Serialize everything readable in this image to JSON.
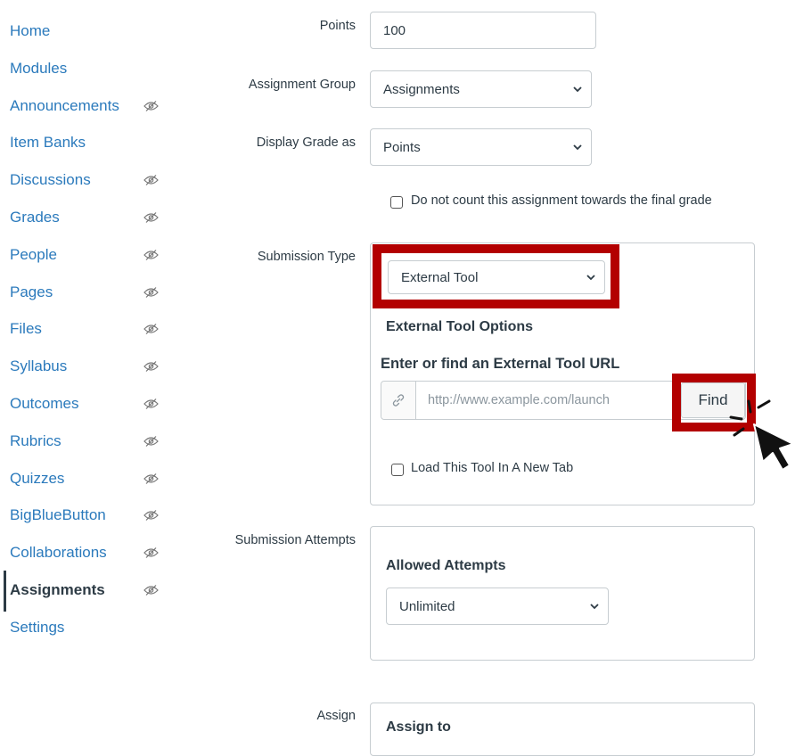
{
  "sidebar": {
    "items": [
      {
        "label": "Home",
        "hidden": false
      },
      {
        "label": "Modules",
        "hidden": false
      },
      {
        "label": "Announcements",
        "hidden": true
      },
      {
        "label": "Item Banks",
        "hidden": false
      },
      {
        "label": "Discussions",
        "hidden": true
      },
      {
        "label": "Grades",
        "hidden": true
      },
      {
        "label": "People",
        "hidden": true
      },
      {
        "label": "Pages",
        "hidden": true
      },
      {
        "label": "Files",
        "hidden": true
      },
      {
        "label": "Syllabus",
        "hidden": true
      },
      {
        "label": "Outcomes",
        "hidden": true
      },
      {
        "label": "Rubrics",
        "hidden": true
      },
      {
        "label": "Quizzes",
        "hidden": true
      },
      {
        "label": "BigBlueButton",
        "hidden": true
      },
      {
        "label": "Collaborations",
        "hidden": true
      },
      {
        "label": "Assignments",
        "hidden": true,
        "active": true
      },
      {
        "label": "Settings",
        "hidden": false
      }
    ],
    "link_color": "#2b7abc"
  },
  "form": {
    "points": {
      "label": "Points",
      "value": "100"
    },
    "assignment_group": {
      "label": "Assignment Group",
      "value": "Assignments"
    },
    "display_grade": {
      "label": "Display Grade as",
      "value": "Points"
    },
    "exclude_final": {
      "label": "Do not count this assignment towards the final grade",
      "checked": false
    },
    "submission_type": {
      "label": "Submission Type",
      "value": "External Tool",
      "options_heading": "External Tool Options",
      "url_heading": "Enter or find an External Tool URL",
      "url_placeholder": "http://www.example.com/launch",
      "find_label": "Find",
      "new_tab_label": "Load This Tool In A New Tab",
      "new_tab_checked": false
    },
    "submission_attempts": {
      "label": "Submission Attempts",
      "heading": "Allowed Attempts",
      "value": "Unlimited"
    },
    "assign": {
      "label": "Assign",
      "heading": "Assign to"
    }
  },
  "annotation": {
    "highlight_color": "#b30000"
  }
}
